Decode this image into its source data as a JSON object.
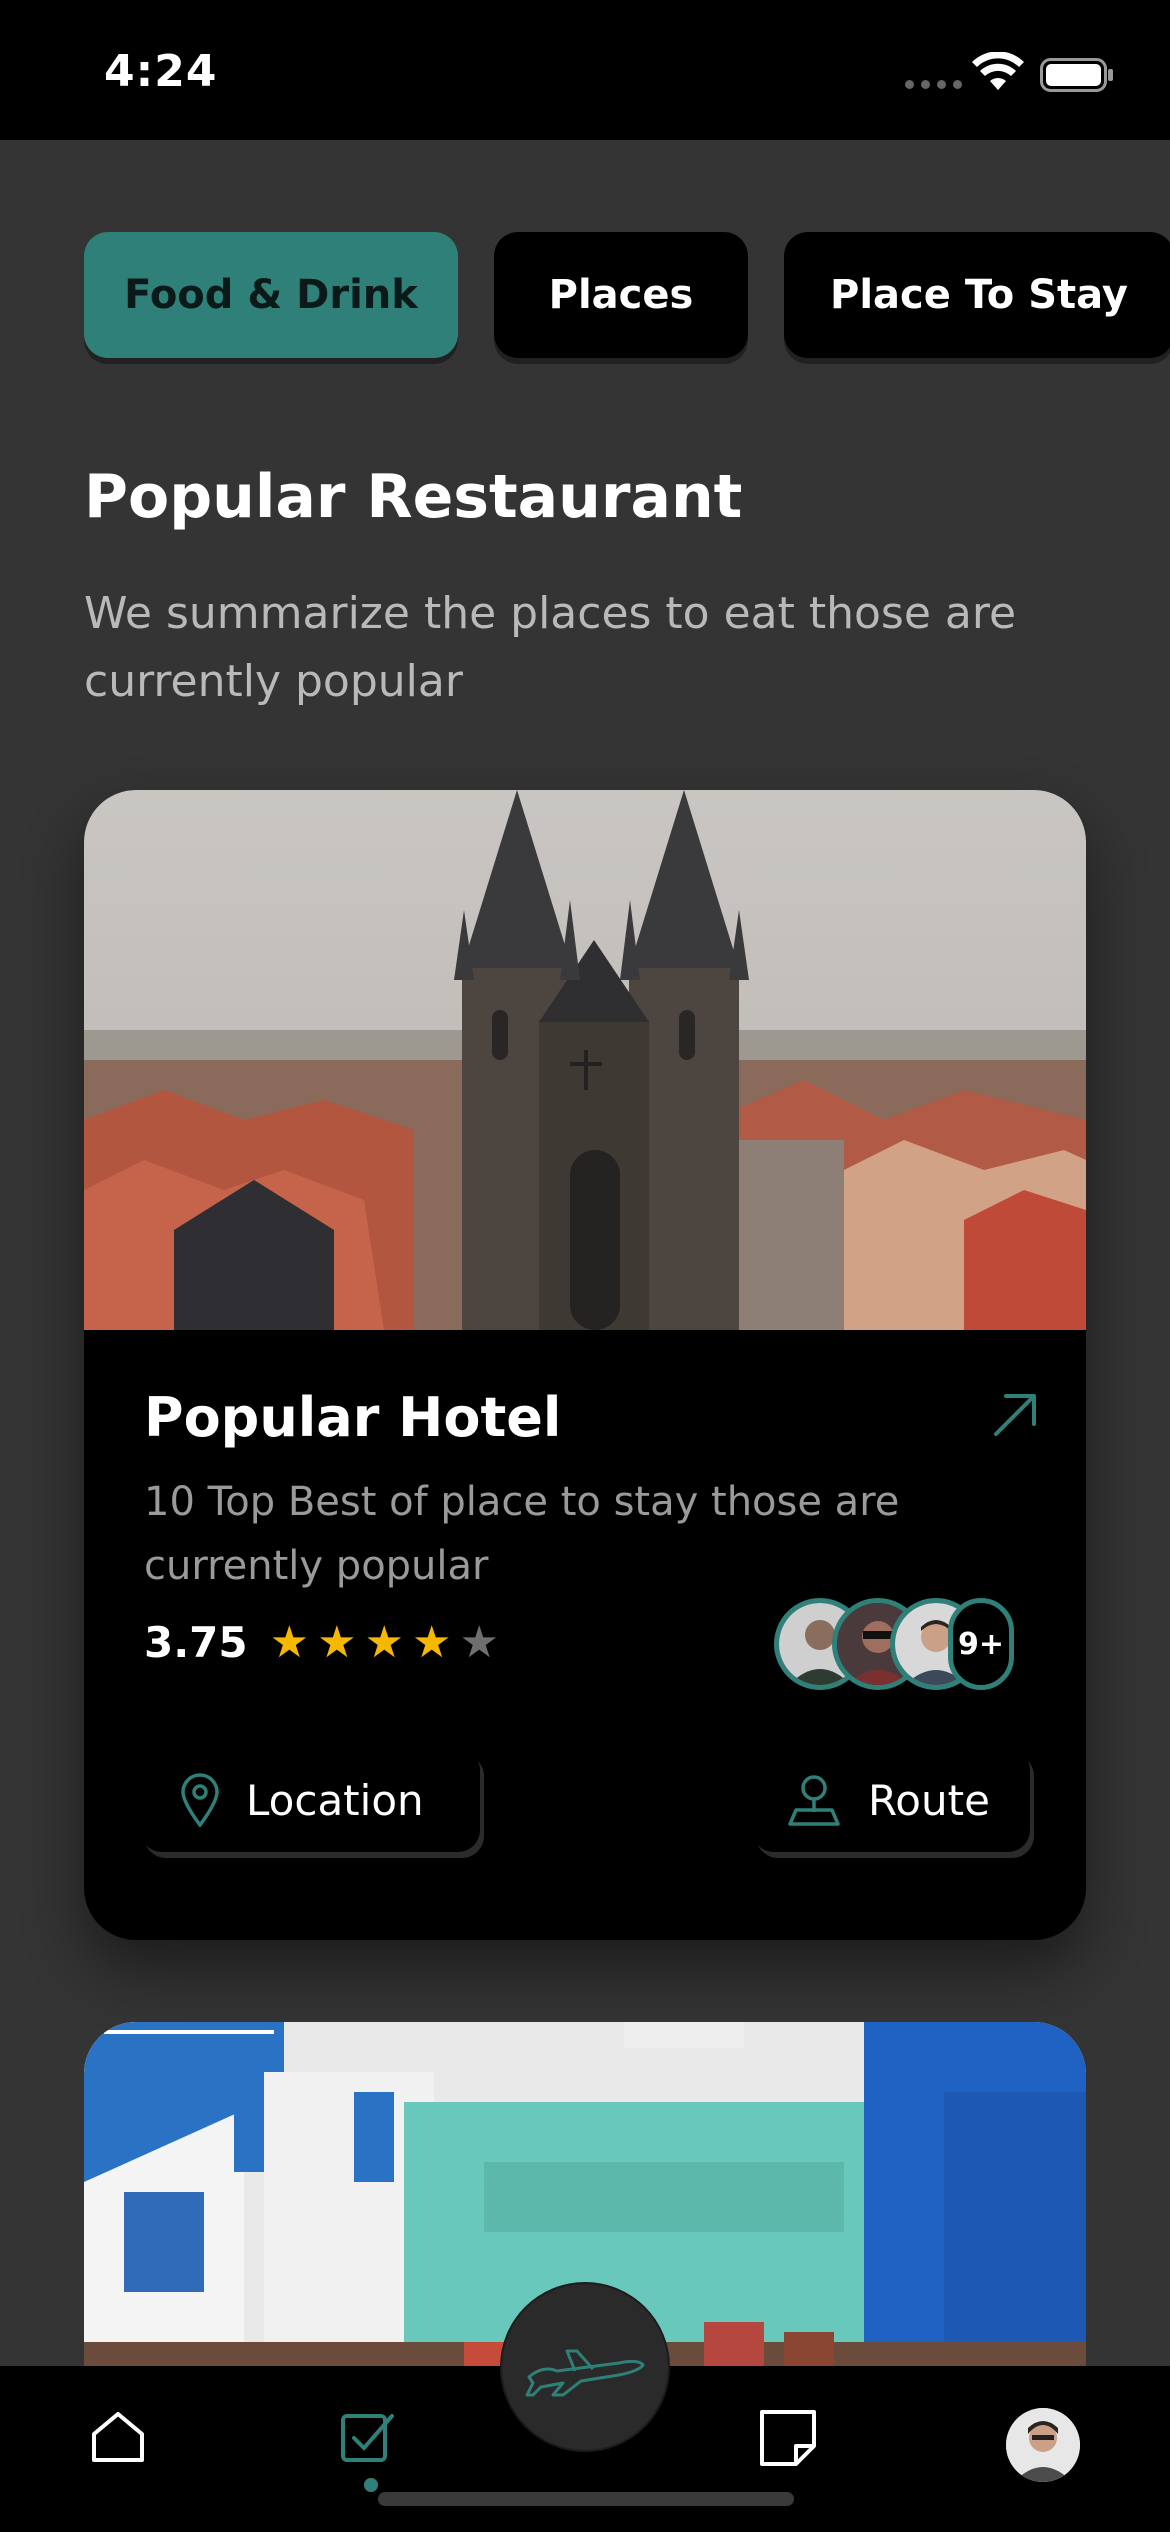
{
  "status_bar": {
    "time": "4:24"
  },
  "tabs": [
    {
      "label": "Food & Drink",
      "active": true
    },
    {
      "label": "Places",
      "active": false
    },
    {
      "label": "Place To Stay",
      "active": false
    }
  ],
  "section": {
    "title": "Popular Restaurant",
    "description": "We summarize the places to eat those are currently popular"
  },
  "card": {
    "image_icon": "prague-church-photo",
    "title": "Popular Hotel",
    "description": "10 Top Best of place to stay those are currently popular",
    "rating": "3.75",
    "stars_filled": 4,
    "stars_total": 5,
    "avatars_more": "9+",
    "location_label": "Location",
    "route_label": "Route"
  },
  "colors": {
    "accent": "#2f8079",
    "background": "#343434",
    "card": "#000000",
    "star": "#f5b700"
  },
  "bottom_nav": {
    "items": [
      "home-icon",
      "tasks-icon",
      "plane-icon",
      "notes-icon",
      "profile-avatar"
    ]
  }
}
